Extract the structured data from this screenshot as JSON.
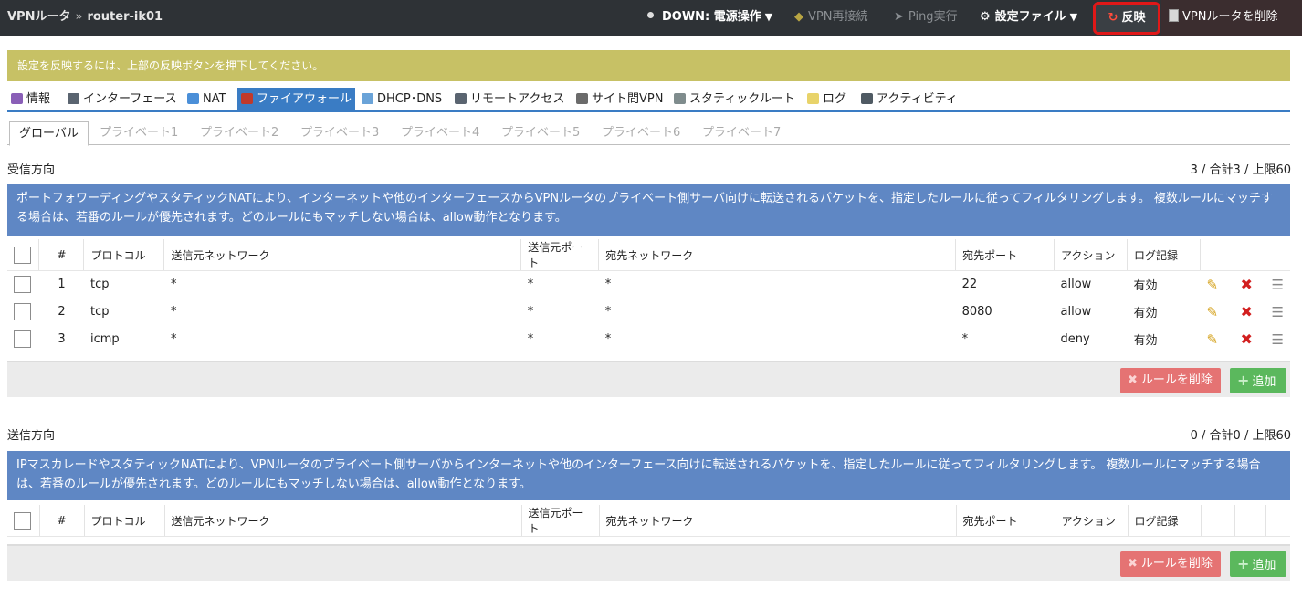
{
  "header": {
    "app_name": "VPNルータ",
    "separator": "»",
    "router_name": "router-ik01",
    "status_label": "DOWN: 電源操作",
    "vpn_reconnect": "VPN再接続",
    "ping": "Ping実行",
    "config_file": "設定ファイル",
    "reflect": "反映",
    "delete_router": "VPNルータを削除"
  },
  "notice": "設定を反映するには、上部の反映ボタンを押下してください。",
  "main_tabs": [
    "情報",
    "インターフェース",
    "NAT",
    "ファイアウォール",
    "DHCP･DNS",
    "リモートアクセス",
    "サイト間VPN",
    "スタティックルート",
    "ログ",
    "アクティビティ"
  ],
  "active_main_tab": "ファイアウォール",
  "sub_tabs": [
    "グローバル",
    "プライベート1",
    "プライベート2",
    "プライベート3",
    "プライベート4",
    "プライベート5",
    "プライベート6",
    "プライベート7"
  ],
  "columns": [
    "#",
    "プロトコル",
    "送信元ネットワーク",
    "送信元ポート",
    "宛先ネットワーク",
    "宛先ポート",
    "アクション",
    "ログ記録"
  ],
  "inbound": {
    "title": "受信方向",
    "count": "3 / 合計3 / 上限60",
    "description": "ポートフォワーディングやスタティックNATにより、インターネットや他のインターフェースからVPNルータのプライベート側サーバ向けに転送されるパケットを、指定したルールに従ってフィルタリングします。 複数ルールにマッチする場合は、若番のルールが優先されます。どのルールにもマッチしない場合は、allow動作となります。",
    "rows": [
      {
        "no": "1",
        "protocol": "tcp",
        "src_net": "*",
        "src_port": "*",
        "dst_net": "*",
        "dst_port": "22",
        "action": "allow",
        "log": "有効"
      },
      {
        "no": "2",
        "protocol": "tcp",
        "src_net": "*",
        "src_port": "*",
        "dst_net": "*",
        "dst_port": "8080",
        "action": "allow",
        "log": "有効"
      },
      {
        "no": "3",
        "protocol": "icmp",
        "src_net": "*",
        "src_port": "*",
        "dst_net": "*",
        "dst_port": "*",
        "action": "deny",
        "log": "有効"
      }
    ]
  },
  "outbound": {
    "title": "送信方向",
    "count": "0 / 合計0 / 上限60",
    "description": "IPマスカレードやスタティックNATにより、VPNルータのプライベート側サーバからインターネットや他のインターフェース向けに転送されるパケットを、指定したルールに従ってフィルタリングします。 複数ルールにマッチする場合は、若番のルールが優先されます。どのルールにもマッチしない場合は、allow動作となります。"
  },
  "buttons": {
    "delete_rule": "ルールを削除",
    "add": "追加"
  },
  "colors": {
    "topbar": "#2e3236",
    "notice": "#c7c165",
    "desc": "#5f87c4",
    "active_tab": "#3a7cc4",
    "delete_btn": "#e57373",
    "add_btn": "#5bb85d",
    "highlight": "#e01818"
  }
}
